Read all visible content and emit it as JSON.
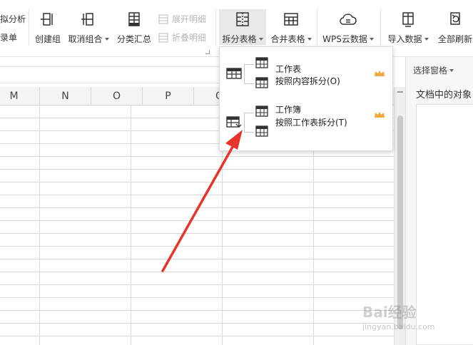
{
  "ribbon": {
    "left_partial": [
      "拟分析",
      "录单"
    ],
    "create_group": "创建组",
    "ungroup": "取消组合",
    "subtotal": "分类汇总",
    "expand_detail": "展开明细",
    "collapse_detail": "折叠明细",
    "split_table": "拆分表格",
    "merge_table": "合并表格",
    "wps_cloud": "WPS云数据",
    "import_data": "导入数据",
    "refresh_all": "全部刷新"
  },
  "columns": [
    "M",
    "N",
    "O",
    "P",
    "Q",
    "",
    "",
    "",
    ""
  ],
  "right_pane": {
    "title": "选择窗格",
    "subtitle": "文档中的对象"
  },
  "split_menu": {
    "items": [
      {
        "title": "工作表",
        "subtitle": "按照内容拆分(O)"
      },
      {
        "title": "工作簿",
        "subtitle": "按照工作表拆分(T)"
      }
    ]
  },
  "watermark": {
    "brand": "Bai经验",
    "url": "jingyan.baidu.com"
  },
  "colors": {
    "accent_active": "#e8e8e8",
    "crown": "#f0a93a",
    "arrow": "#e8332a"
  }
}
